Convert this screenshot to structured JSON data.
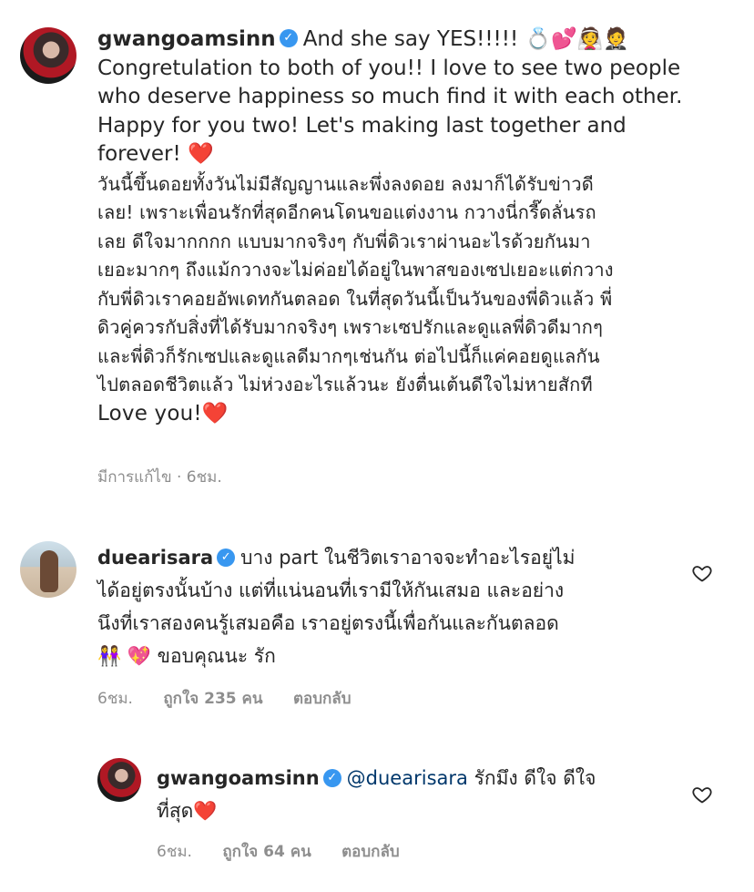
{
  "comments": [
    {
      "username": "gwangoamsinn",
      "verified": true,
      "lines": [
        "And she say YES!!!!! 💍💕👰🤵",
        "Congretulation to both of you!! I love to see two people",
        "who deserve happiness so much find it with each other.",
        "Happy for you two! Let's making last together and",
        "forever! ❤️"
      ],
      "thai_lines": [
        "วันนี้ขึ้นดอยทั้งวันไม่มีสัญญานและพึ่งลงดอย ลงมาก็ได้รับข่าวดี",
        "เลย! เพราะเพื่อนรักที่สุดอีกคนโดนขอแต่งงาน กวางนี่กรี๊ดลั่นรถ",
        "เลย ดีใจมากกกก แบบมากจริงๆ กับพี่ดิวเราผ่านอะไรด้วยกันมา",
        "เยอะมากๆ ถึงแม้กวางจะไม่ค่อยได้อยู่ในพาสของเซปเยอะแต่กวาง",
        "กับพี่ดิวเราคอยอัพเดทกันตลอด ในที่สุดวันนี้เป็นวันของพี่ดิวแล้ว พี่",
        "ดิวคู่ควรกับสิ่งที่ได้รับมากจริงๆ เพราะเซปรักและดูแลพี่ดิวดีมากๆ",
        "และพี่ดิวก็รักเซปและดูแลดีมากๆเช่นกัน ต่อไปนี้ก็แค่คอยดูแลกัน",
        "ไปตลอดชีวิตแล้ว ไม่ห่วงอะไรแล้วนะ ยังตื่นเต้นดีใจไม่หายสักที",
        "Love you!❤️"
      ],
      "meta": "มีการแก้ไข · 6ชม."
    },
    {
      "username": "duearisara",
      "verified": true,
      "lines": [
        "บาง part ในชีวิตเราอาจจะทำอะไรอยู่ไม่",
        "ได้อยู่ตรงนั้นบ้าง แต่ที่แน่นอนที่เรามีให้กันเสมอ และอย่าง",
        "นึงที่เราสองคนรู้เสมอคือ เราอยู่ตรงนี้เพื่อกันและกันตลอด",
        "👭 💖 ขอบคุณนะ รัก"
      ],
      "time": "6ชม.",
      "likes": "ถูกใจ 235 คน",
      "reply": "ตอบกลับ"
    },
    {
      "username": "gwangoamsinn",
      "verified": true,
      "mention": "@duearisara",
      "lines": [
        "รักมึง ดีใจ ดีใจ",
        "ที่สุด❤️"
      ],
      "time": "6ชม.",
      "likes": "ถูกใจ 64 คน",
      "reply": "ตอบกลับ"
    }
  ],
  "icons": {
    "verified": "verified-badge-icon",
    "like": "heart-outline-icon"
  },
  "colors": {
    "verified": "#3897f0",
    "heart": "#ed4956",
    "meta": "#8e8e8e",
    "mention": "#00376b"
  }
}
